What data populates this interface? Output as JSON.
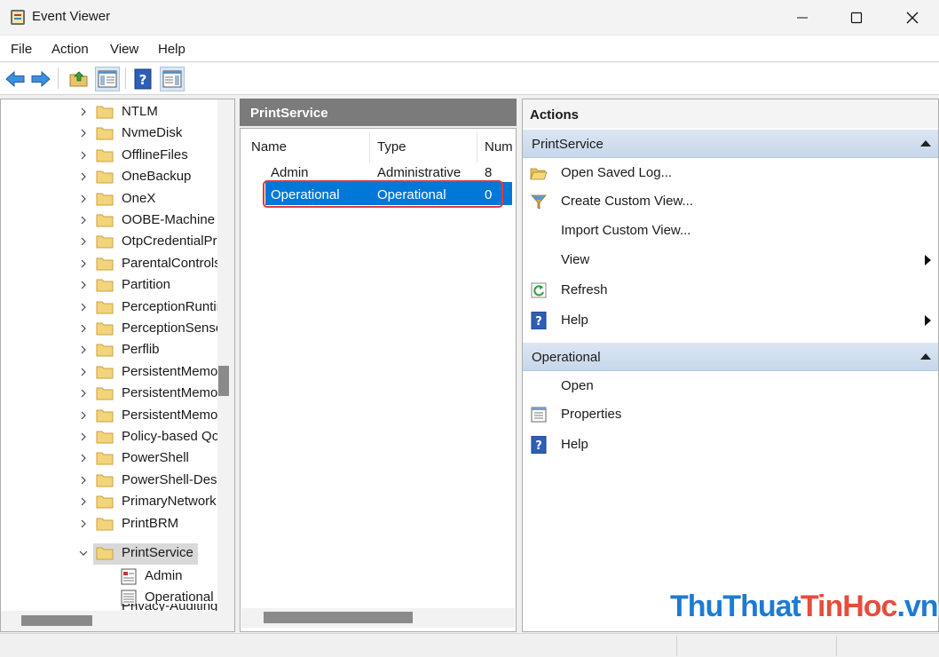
{
  "window": {
    "title": "Event Viewer"
  },
  "menu": [
    "File",
    "Action",
    "View",
    "Help"
  ],
  "tree": {
    "items": [
      "NTLM",
      "NvmeDisk",
      "OfflineFiles",
      "OneBackup",
      "OneX",
      "OOBE-Machine",
      "OtpCredentialProvider",
      "ParentalControls",
      "Partition",
      "PerceptionRuntime",
      "PerceptionSensorDataService",
      "Perflib",
      "PersistentMemory-Nvdimm",
      "PersistentMemory-PmemDisk",
      "PersistentMemory-ScmBus",
      "Policy-based QoS",
      "PowerShell",
      "PowerShell-DesiredStateConfiguration",
      "PrimaryNetworkIcon",
      "PrintBRM",
      "PrintService"
    ],
    "selected": "PrintService",
    "children": [
      "Admin",
      "Operational"
    ],
    "partial_next": "Privacy-Auditing"
  },
  "middle": {
    "header": "PrintService",
    "columns": [
      "Name",
      "Type",
      "Num"
    ],
    "rows": [
      {
        "name": "Admin",
        "type": "Administrative",
        "num": "8"
      },
      {
        "name": "Operational",
        "type": "Operational",
        "num": "0"
      }
    ],
    "selected_row": "Operational"
  },
  "actions": {
    "title": "Actions",
    "sections": [
      {
        "header": "PrintService",
        "items": [
          {
            "label": "Open Saved Log...",
            "icon": "folder-open-icon"
          },
          {
            "label": "Create Custom View...",
            "icon": "filter-funnel-icon"
          },
          {
            "label": "Import Custom View...",
            "icon": ""
          },
          {
            "label": "View",
            "icon": "",
            "submenu": true
          },
          {
            "label": "Refresh",
            "icon": "refresh-icon"
          },
          {
            "label": "Help",
            "icon": "help-icon",
            "submenu": true
          }
        ]
      },
      {
        "header": "Operational",
        "items": [
          {
            "label": "Open",
            "icon": ""
          },
          {
            "label": "Properties",
            "icon": "properties-icon"
          },
          {
            "label": "Help",
            "icon": "help-icon"
          }
        ]
      }
    ]
  },
  "watermark": {
    "part1": "ThuThuat",
    "part2": "TinHoc",
    "part3": ".vn"
  },
  "colors": {
    "selection": "#0078d7",
    "highlight_box": "#e03b3b",
    "section_header": "#c7d7ea",
    "watermark_blue": "#1d7bd2",
    "watermark_red": "#e74c3c"
  }
}
